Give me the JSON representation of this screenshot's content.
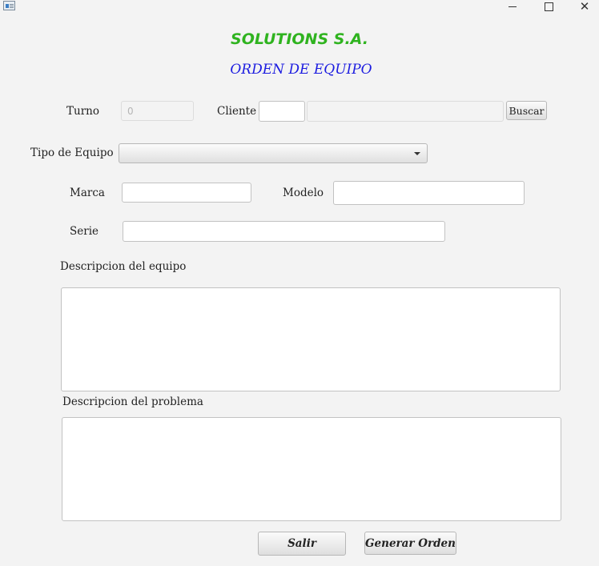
{
  "window": {
    "minimize_label": "",
    "maximize_label": "",
    "close_label": "✕"
  },
  "header": {
    "company": "SOLUTIONS S.A.",
    "form_title": "ORDEN DE EQUIPO"
  },
  "form": {
    "turno_label": "Turno",
    "turno_value": "0",
    "cliente_label": "Cliente",
    "cliente_code": "",
    "cliente_name": "",
    "buscar_label": "Buscar",
    "tipo_label": "Tipo de Equipo",
    "tipo_selected": "",
    "marca_label": "Marca",
    "marca_value": "",
    "modelo_label": "Modelo",
    "modelo_value": "",
    "serie_label": "Serie",
    "serie_value": "",
    "desc_equipo_label": "Descripcion del equipo",
    "desc_equipo_value": "",
    "desc_problema_label": "Descripcion del problema",
    "desc_problema_value": ""
  },
  "actions": {
    "salir_label": "Salir",
    "generar_label": "Generar Orden"
  },
  "colors": {
    "company_title": "#2fb31f",
    "form_title": "#1c1ce0",
    "background": "#f3f3f3"
  }
}
